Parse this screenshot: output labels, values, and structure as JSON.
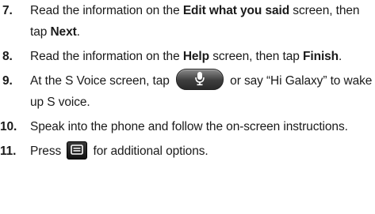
{
  "steps": [
    {
      "num": "7.",
      "pre": "Read the information on the ",
      "bold": "Edit what you said",
      "post": " screen, then tap ",
      "bold2": "Next",
      "end": "."
    },
    {
      "num": "8.",
      "pre": "Read the information on the ",
      "bold": "Help",
      "post": " screen, then tap ",
      "bold2": "Finish",
      "end": "."
    },
    {
      "num": "9.",
      "pre": "At the S Voice screen, tap ",
      "icon": "microphone-icon",
      "post": " or say “Hi Galaxy” to wake up S voice."
    },
    {
      "num": "10.",
      "text": "Speak into the phone and follow the on-screen instructions."
    },
    {
      "num": "11.",
      "pre": "Press ",
      "icon": "menu-key-icon",
      "post": " for additional options."
    }
  ]
}
